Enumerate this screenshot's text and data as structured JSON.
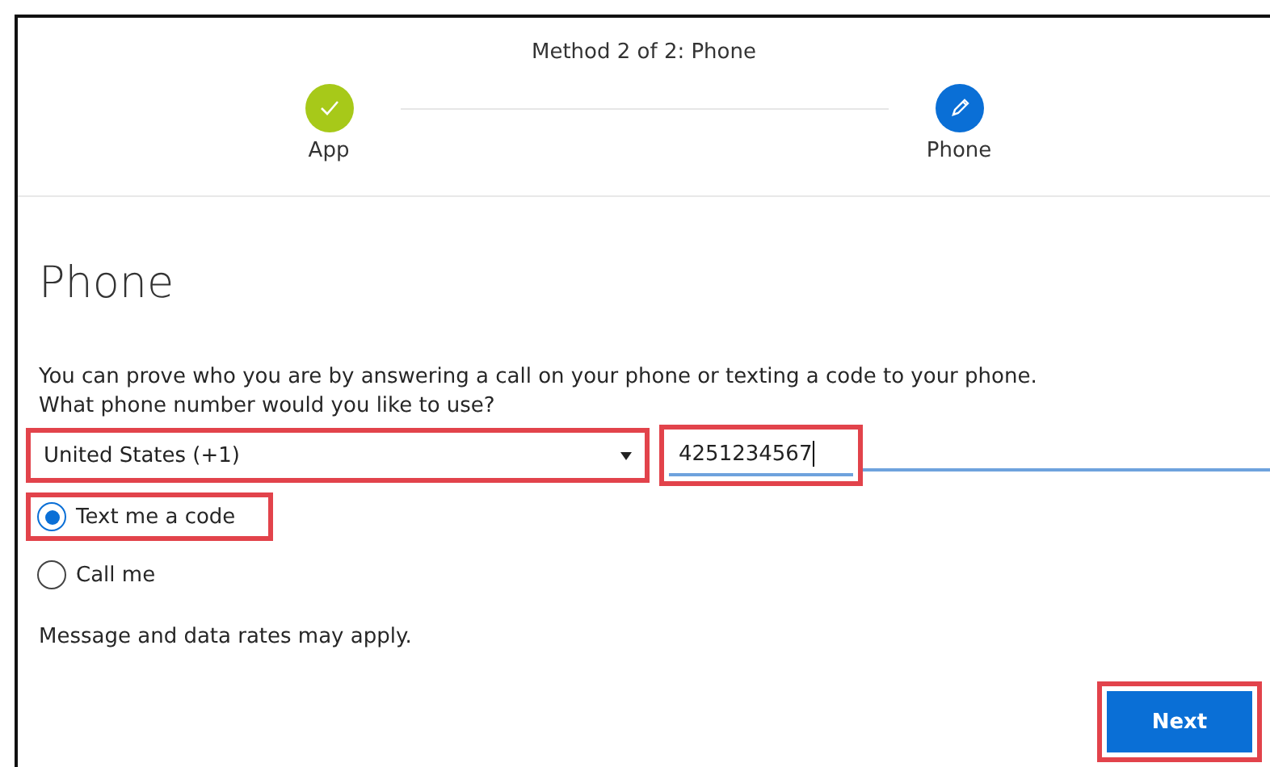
{
  "header": {
    "title": "Method 2 of 2: Phone"
  },
  "steps": [
    {
      "label": "App",
      "kind": "done"
    },
    {
      "label": "Phone",
      "kind": "current"
    }
  ],
  "section": {
    "heading": "Phone",
    "intro": "You can prove who you are by answering a call on your phone or texting a code to your phone.",
    "question": "What phone number would you like to use?"
  },
  "country": {
    "value": "United States (+1)",
    "highlighted": true
  },
  "phone": {
    "value": "4251234567",
    "highlighted": true
  },
  "options": [
    {
      "label": "Text me a code",
      "selected": true,
      "highlighted": true
    },
    {
      "label": "Call me",
      "selected": false,
      "highlighted": false
    }
  ],
  "note": "Message and data rates may apply.",
  "next": {
    "label": "Next",
    "highlighted": true
  }
}
